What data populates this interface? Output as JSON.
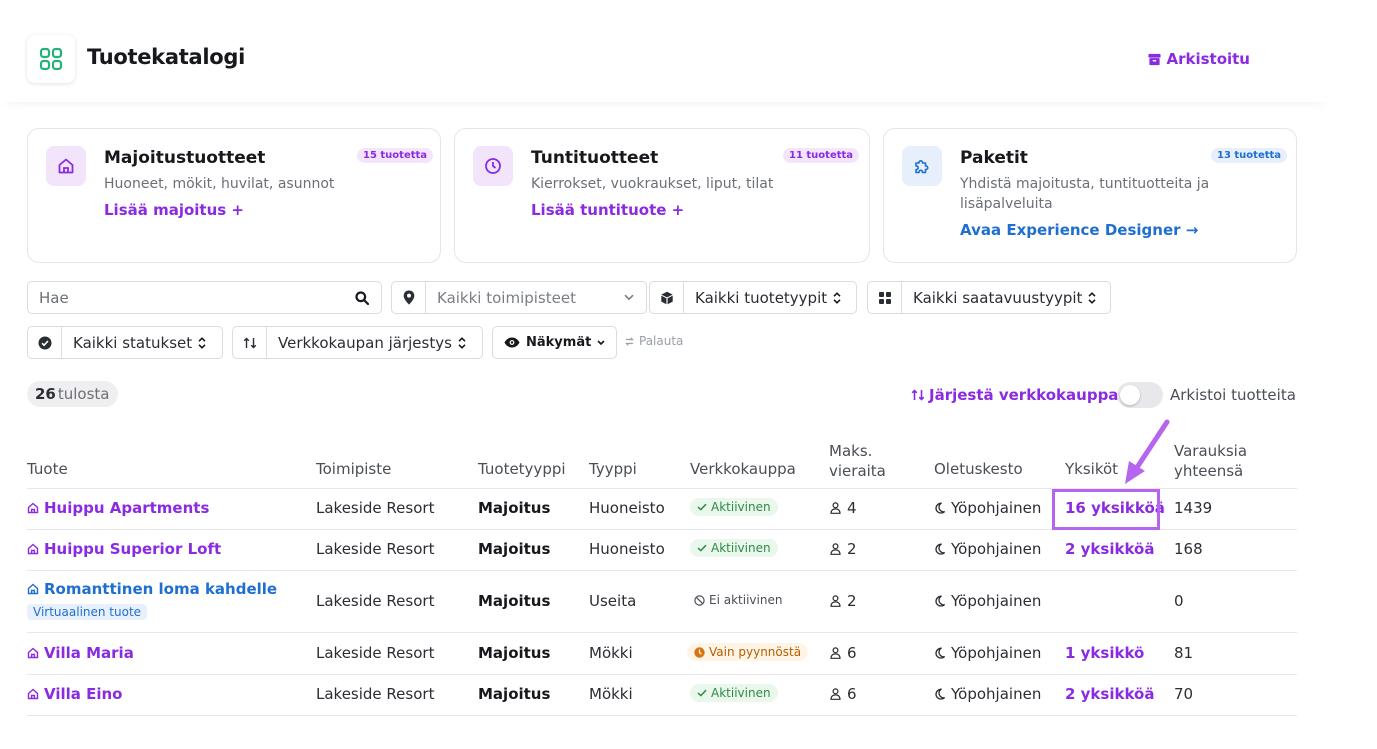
{
  "header": {
    "title": "Tuotekatalogi",
    "archived_label": "Arkistoitu"
  },
  "cards": [
    {
      "title": "Majoitustuotteet",
      "badge": "15 tuotetta",
      "desc": "Huoneet, mökit, huvilat, asunnot",
      "link": "Lisää majoitus +"
    },
    {
      "title": "Tuntituotteet",
      "badge": "11 tuotetta",
      "desc": "Kierrokset, vuokraukset, liput, tilat",
      "link": "Lisää tuntituote +"
    },
    {
      "title": "Paketit",
      "badge": "13 tuotetta",
      "desc_line1": "Yhdistä majoitusta, tuntituotteita ja",
      "desc_line2": "lisäpalveluita",
      "link": "Avaa Experience Designer →"
    }
  ],
  "filters": {
    "search_placeholder": "Hae",
    "location": "Kaikki toimipisteet",
    "product_type": "Kaikki tuotetyypit",
    "availability": "Kaikki saatavuustyypit",
    "status": "Kaikki statukset",
    "order": "Verkkokaupan järjestys",
    "views": "Näkymät",
    "reset": "Palauta"
  },
  "results": {
    "count": "26",
    "count_label": "tulosta",
    "sort_shop": "Järjestä verkkokauppa",
    "archive_toggle_label": "Arkistoi tuotteita",
    "archive_toggle_on": false
  },
  "table": {
    "headers": {
      "product": "Tuote",
      "location": "Toimipiste",
      "product_type": "Tuotetyyppi",
      "type": "Tyyppi",
      "webshop": "Verkkokauppa",
      "max_guests_1": "Maks.",
      "max_guests_2": "vieraita",
      "default_duration": "Oletuskesto",
      "units": "Yksiköt",
      "bookings_1": "Varauksia",
      "bookings_2": "yhteensä"
    },
    "rows": [
      {
        "name": "Huippu Apartments",
        "location": "Lakeside Resort",
        "product_type": "Majoitus",
        "type": "Huoneisto",
        "webshop": "Aktiivinen",
        "webshop_state": "active",
        "guests": "4",
        "duration": "Yöpohjainen",
        "units": "16 yksikköä",
        "bookings": "1439"
      },
      {
        "name": "Huippu Superior Loft",
        "location": "Lakeside Resort",
        "product_type": "Majoitus",
        "type": "Huoneisto",
        "webshop": "Aktiivinen",
        "webshop_state": "active",
        "guests": "2",
        "duration": "Yöpohjainen",
        "units": "2 yksikköä",
        "bookings": "168"
      },
      {
        "name": "Romanttinen loma kahdelle",
        "tag": "Virtuaalinen tuote",
        "location": "Lakeside Resort",
        "product_type": "Majoitus",
        "type": "Useita",
        "webshop": "Ei aktiivinen",
        "webshop_state": "inactive",
        "guests": "2",
        "duration": "Yöpohjainen",
        "units": "",
        "bookings": "0"
      },
      {
        "name": "Villa Maria",
        "location": "Lakeside Resort",
        "product_type": "Majoitus",
        "type": "Mökki",
        "webshop": "Vain pyynnöstä",
        "webshop_state": "request",
        "guests": "6",
        "duration": "Yöpohjainen",
        "units": "1 yksikkö",
        "bookings": "81"
      },
      {
        "name": "Villa Eino",
        "location": "Lakeside Resort",
        "product_type": "Majoitus",
        "type": "Mökki",
        "webshop": "Aktiivinen",
        "webshop_state": "active",
        "guests": "6",
        "duration": "Yöpohjainen",
        "units": "2 yksikköä",
        "bookings": "70"
      }
    ]
  },
  "colors": {
    "accent": "#8a2be2",
    "link_blue": "#1f6fd1",
    "active_green": "#2e8b44",
    "request_orange": "#d9730d",
    "highlight": "#b565ee"
  }
}
